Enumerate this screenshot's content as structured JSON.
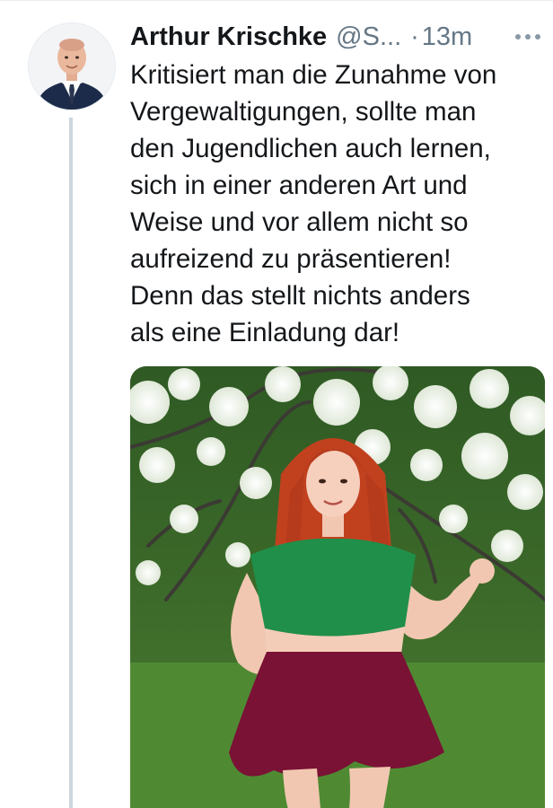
{
  "tweet": {
    "author_name": "Arthur Krischke",
    "author_handle": "@S...",
    "separator": "·",
    "time": "13m",
    "text": "Kritisiert man die Zunahme von\nVergewaltigungen, sollte man\nden Jugendlichen auch lernen,\nsich in einer anderen Art und\nWeise und vor allem nicht so\naufreizend zu präsentieren!\nDenn das stellt nichts anders\nals eine Einladung dar!",
    "more_icon": "more-horizontal-icon",
    "avatar_icon": "user-avatar",
    "media_icon": "photo-image"
  },
  "colors": {
    "text": "#14171a",
    "secondary": "#657786",
    "thread_line": "#ccd6dd"
  }
}
